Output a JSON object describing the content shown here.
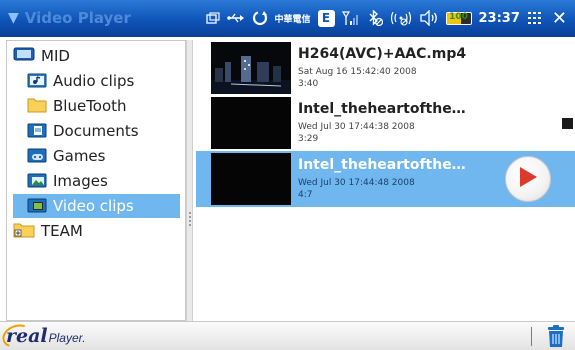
{
  "header": {
    "app_title": "Video Player",
    "carrier": "中華電信",
    "network_badge": "E",
    "battery_level": 0.6,
    "battery_label": "100",
    "time": "23:37"
  },
  "sidebar": {
    "items": [
      {
        "label": "MID",
        "icon": "device-icon"
      },
      {
        "label": "Audio clips",
        "icon": "audio-folder-icon"
      },
      {
        "label": "BlueTooth",
        "icon": "folder-icon"
      },
      {
        "label": "Documents",
        "icon": "documents-folder-icon"
      },
      {
        "label": "Games",
        "icon": "games-folder-icon"
      },
      {
        "label": "Images",
        "icon": "images-folder-icon"
      },
      {
        "label": "Video clips",
        "icon": "video-folder-icon",
        "selected": true
      },
      {
        "label": "TEAM",
        "icon": "team-folder-icon"
      }
    ]
  },
  "files": [
    {
      "title": "H264(AVC)+AAC.mp4",
      "date": "Sat Aug 16 15:42:40 2008",
      "duration": "3:40",
      "selected": false
    },
    {
      "title": "Intel_theheartofthe…",
      "date": "Wed Jul 30 17:44:38 2008",
      "duration": "3:29",
      "selected": false
    },
    {
      "title": "Intel_theheartofthe…",
      "date": "Wed Jul 30 17:44:48 2008",
      "duration": "4:7",
      "selected": true
    }
  ],
  "footer": {
    "logo_real": "real",
    "logo_player": "Player."
  },
  "colors": {
    "topbar": "#0f54b8",
    "selection": "#6fb7ee",
    "play_triangle": "#d93a2b",
    "logo": "#1f2d6e",
    "trash": "#1c6fc4"
  }
}
